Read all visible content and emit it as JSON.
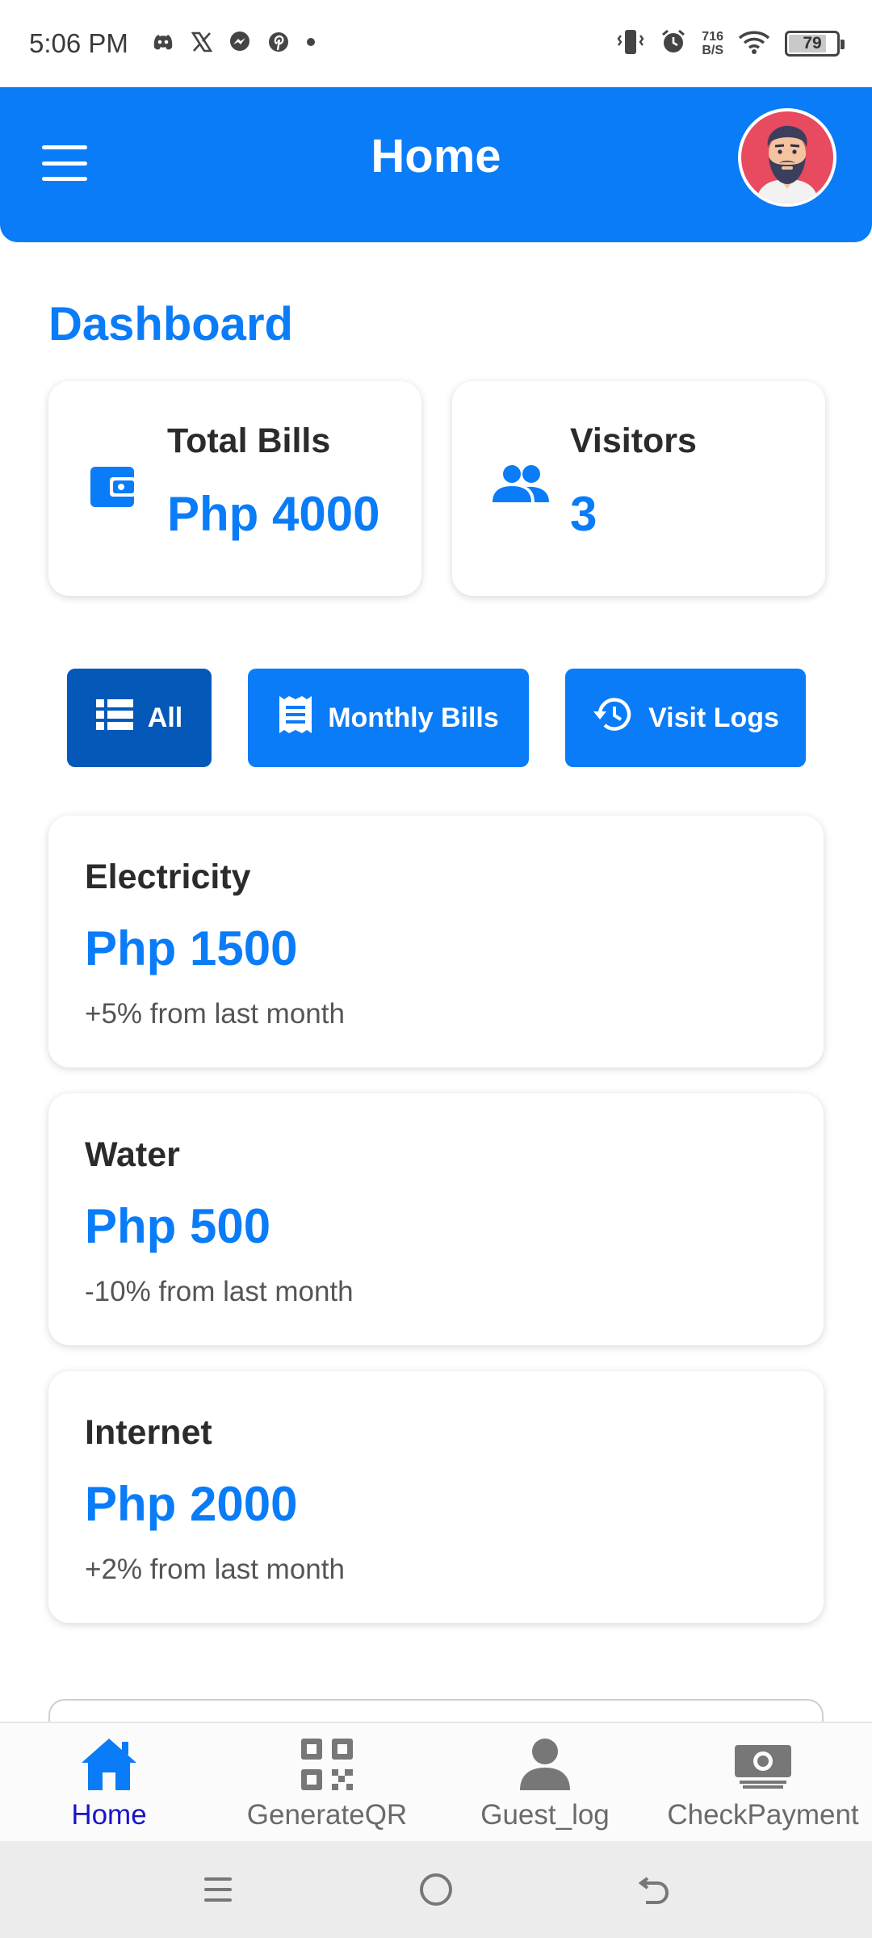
{
  "status_bar": {
    "time": "5:06 PM",
    "net_speed_value": "716",
    "net_speed_unit": "B/S",
    "battery": "79",
    "icons": [
      "discord-icon",
      "x-icon",
      "messenger-icon",
      "pinterest-icon",
      "dot-icon",
      "vibrate-icon",
      "alarm-icon",
      "wifi-icon",
      "battery-icon"
    ]
  },
  "app_bar": {
    "title": "Home",
    "menu_icon": "hamburger-menu-icon",
    "avatar": "bearded-man-avatar"
  },
  "dashboard": {
    "title": "Dashboard",
    "total_bills": {
      "label": "Total Bills",
      "value": "Php 4000",
      "icon": "wallet-icon"
    },
    "visitors": {
      "label": "Visitors",
      "value": "3",
      "icon": "people-icon"
    }
  },
  "filters": [
    {
      "label": "All",
      "icon": "list-icon",
      "active": true
    },
    {
      "label": "Monthly Bills",
      "icon": "receipt-icon",
      "active": false
    },
    {
      "label": "Visit Logs",
      "icon": "history-icon",
      "active": false
    }
  ],
  "bills": [
    {
      "name": "Electricity",
      "amount": "Php 1500",
      "change": "+5% from last month"
    },
    {
      "name": "Water",
      "amount": "Php 500",
      "change": "-10% from last month"
    },
    {
      "name": "Internet",
      "amount": "Php 2000",
      "change": "+2% from last month"
    }
  ],
  "bottom_nav": [
    {
      "label": "Home",
      "icon": "home-icon",
      "active": true
    },
    {
      "label": "GenerateQR",
      "icon": "qr-code-icon",
      "active": false
    },
    {
      "label": "Guest_log",
      "icon": "person-icon",
      "active": false
    },
    {
      "label": "CheckPayment",
      "icon": "payment-icon",
      "active": false
    }
  ],
  "colors": {
    "primary": "#0a7cf7",
    "primary_dark": "#0458b8",
    "nav_active_label": "#1a14c9",
    "text_dark": "#2b2b2b",
    "text_muted": "#555555"
  }
}
